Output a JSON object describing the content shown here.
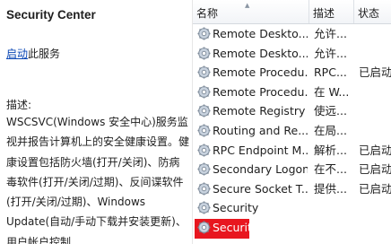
{
  "detail": {
    "service_title": "Security Center",
    "start_link": "启动",
    "start_suffix": "此服务",
    "description_label": "描述:",
    "description_text": "WSCSVC(Windows 安全中心)服务监视并报告计算机上的安全健康设置。健康设置包括防火墙(打开/关闭)、防病毒软件(打开/关闭/过期)、反间谍软件(打开/关闭/过期)、Windows Update(自动/手动下载并安装更新)、用户帐户控制"
  },
  "list": {
    "columns": {
      "name": "名称",
      "description": "描述",
      "status": "状态"
    },
    "rows": [
      {
        "name": "Remote Deskto...",
        "description": "允许...",
        "status": ""
      },
      {
        "name": "Remote Deskto...",
        "description": "允许...",
        "status": ""
      },
      {
        "name": "Remote Procedu...",
        "description": "RPC...",
        "status": "已启动"
      },
      {
        "name": "Remote Procedu...",
        "description": "在 W...",
        "status": ""
      },
      {
        "name": "Remote Registry",
        "description": "使远...",
        "status": ""
      },
      {
        "name": "Routing and Re...",
        "description": "在局...",
        "status": ""
      },
      {
        "name": "RPC Endpoint M...",
        "description": "解析...",
        "status": "已启动"
      },
      {
        "name": "Secondary Logon",
        "description": "在不...",
        "status": "已启动"
      },
      {
        "name": "Secure Socket T...",
        "description": "提供...",
        "status": "已启动"
      },
      {
        "name": "Security",
        "description": "",
        "status": ""
      },
      {
        "name": "Security",
        "description": "",
        "status": ""
      }
    ],
    "selected_index": 10
  }
}
